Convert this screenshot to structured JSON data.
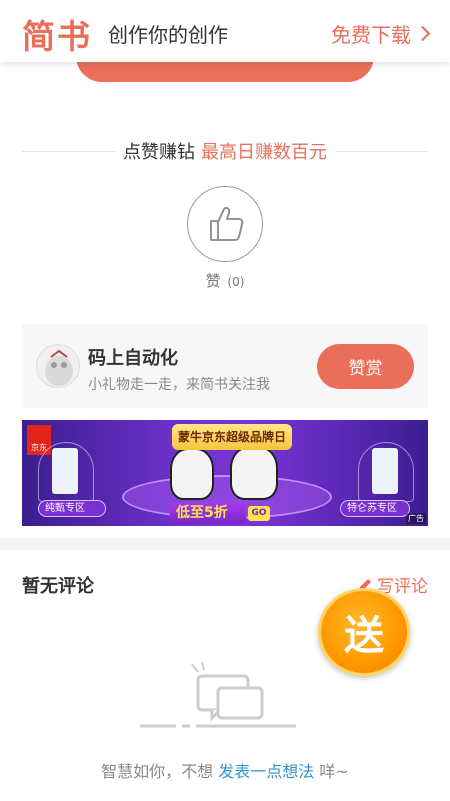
{
  "header": {
    "logo": "简书",
    "slogan": "创作你的创作",
    "download": "免费下载"
  },
  "earn": {
    "label": "点赞赚钻",
    "highlight": "最高日赚数百元"
  },
  "like": {
    "label": "赞",
    "count": "(0)"
  },
  "author": {
    "name": "码上自动化",
    "subtitle": "小礼物走一走，来简书关注我",
    "reward_button": "赞赏"
  },
  "ad": {
    "title": "蒙牛京东超级品牌日",
    "brand": "京东",
    "left_pill": "纯甄专区",
    "right_pill": "特仑苏专区",
    "sale": "低至5折",
    "go": "GO",
    "tag": "广告"
  },
  "comments": {
    "heading": "暂无评论",
    "write": "写评论",
    "badge": "送",
    "empty_prefix": "智慧如你，不想",
    "empty_link": "发表一点想法",
    "empty_suffix": "咩~"
  },
  "colors": {
    "accent": "#ea6f5a",
    "link": "#3194d0"
  }
}
